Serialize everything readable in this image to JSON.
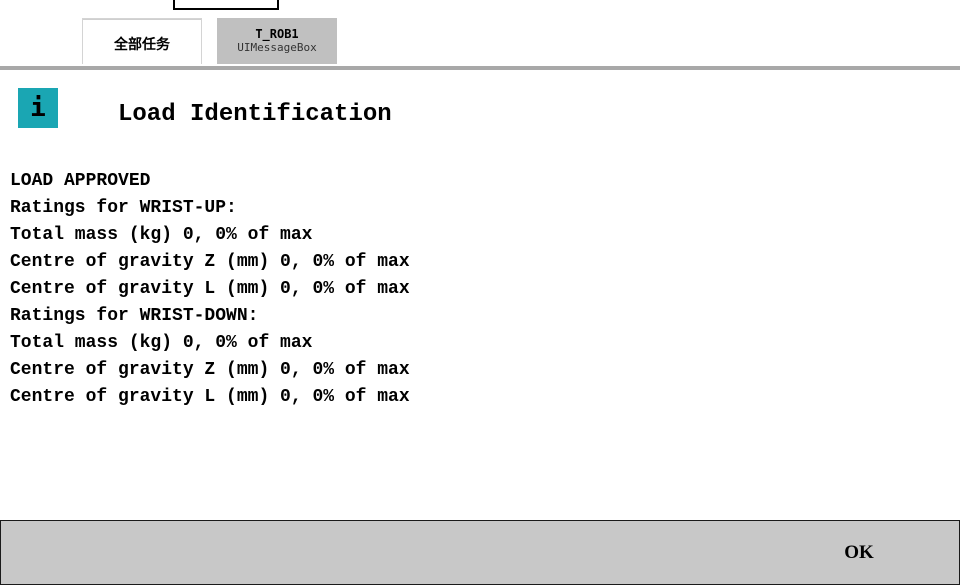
{
  "tabs": [
    {
      "label": "全部任务"
    },
    {
      "title": "T_ROB1",
      "subtitle": "UIMessageBox"
    }
  ],
  "dialog": {
    "icon": "info-icon",
    "icon_glyph": "i",
    "icon_color": "#1aa6b3",
    "title": "Load Identification",
    "message_lines": [
      "LOAD APPROVED",
      "Ratings for WRIST-UP:",
      "Total mass (kg) 0, 0% of max",
      "Centre of gravity Z (mm) 0, 0% of max",
      "Centre of gravity L (mm) 0, 0% of max",
      "Ratings for WRIST-DOWN:",
      "Total mass (kg) 0, 0% of max",
      "Centre of gravity Z (mm) 0, 0% of max",
      "Centre of gravity L (mm) 0, 0% of max"
    ]
  },
  "buttons": {
    "ok_label": "OK"
  }
}
